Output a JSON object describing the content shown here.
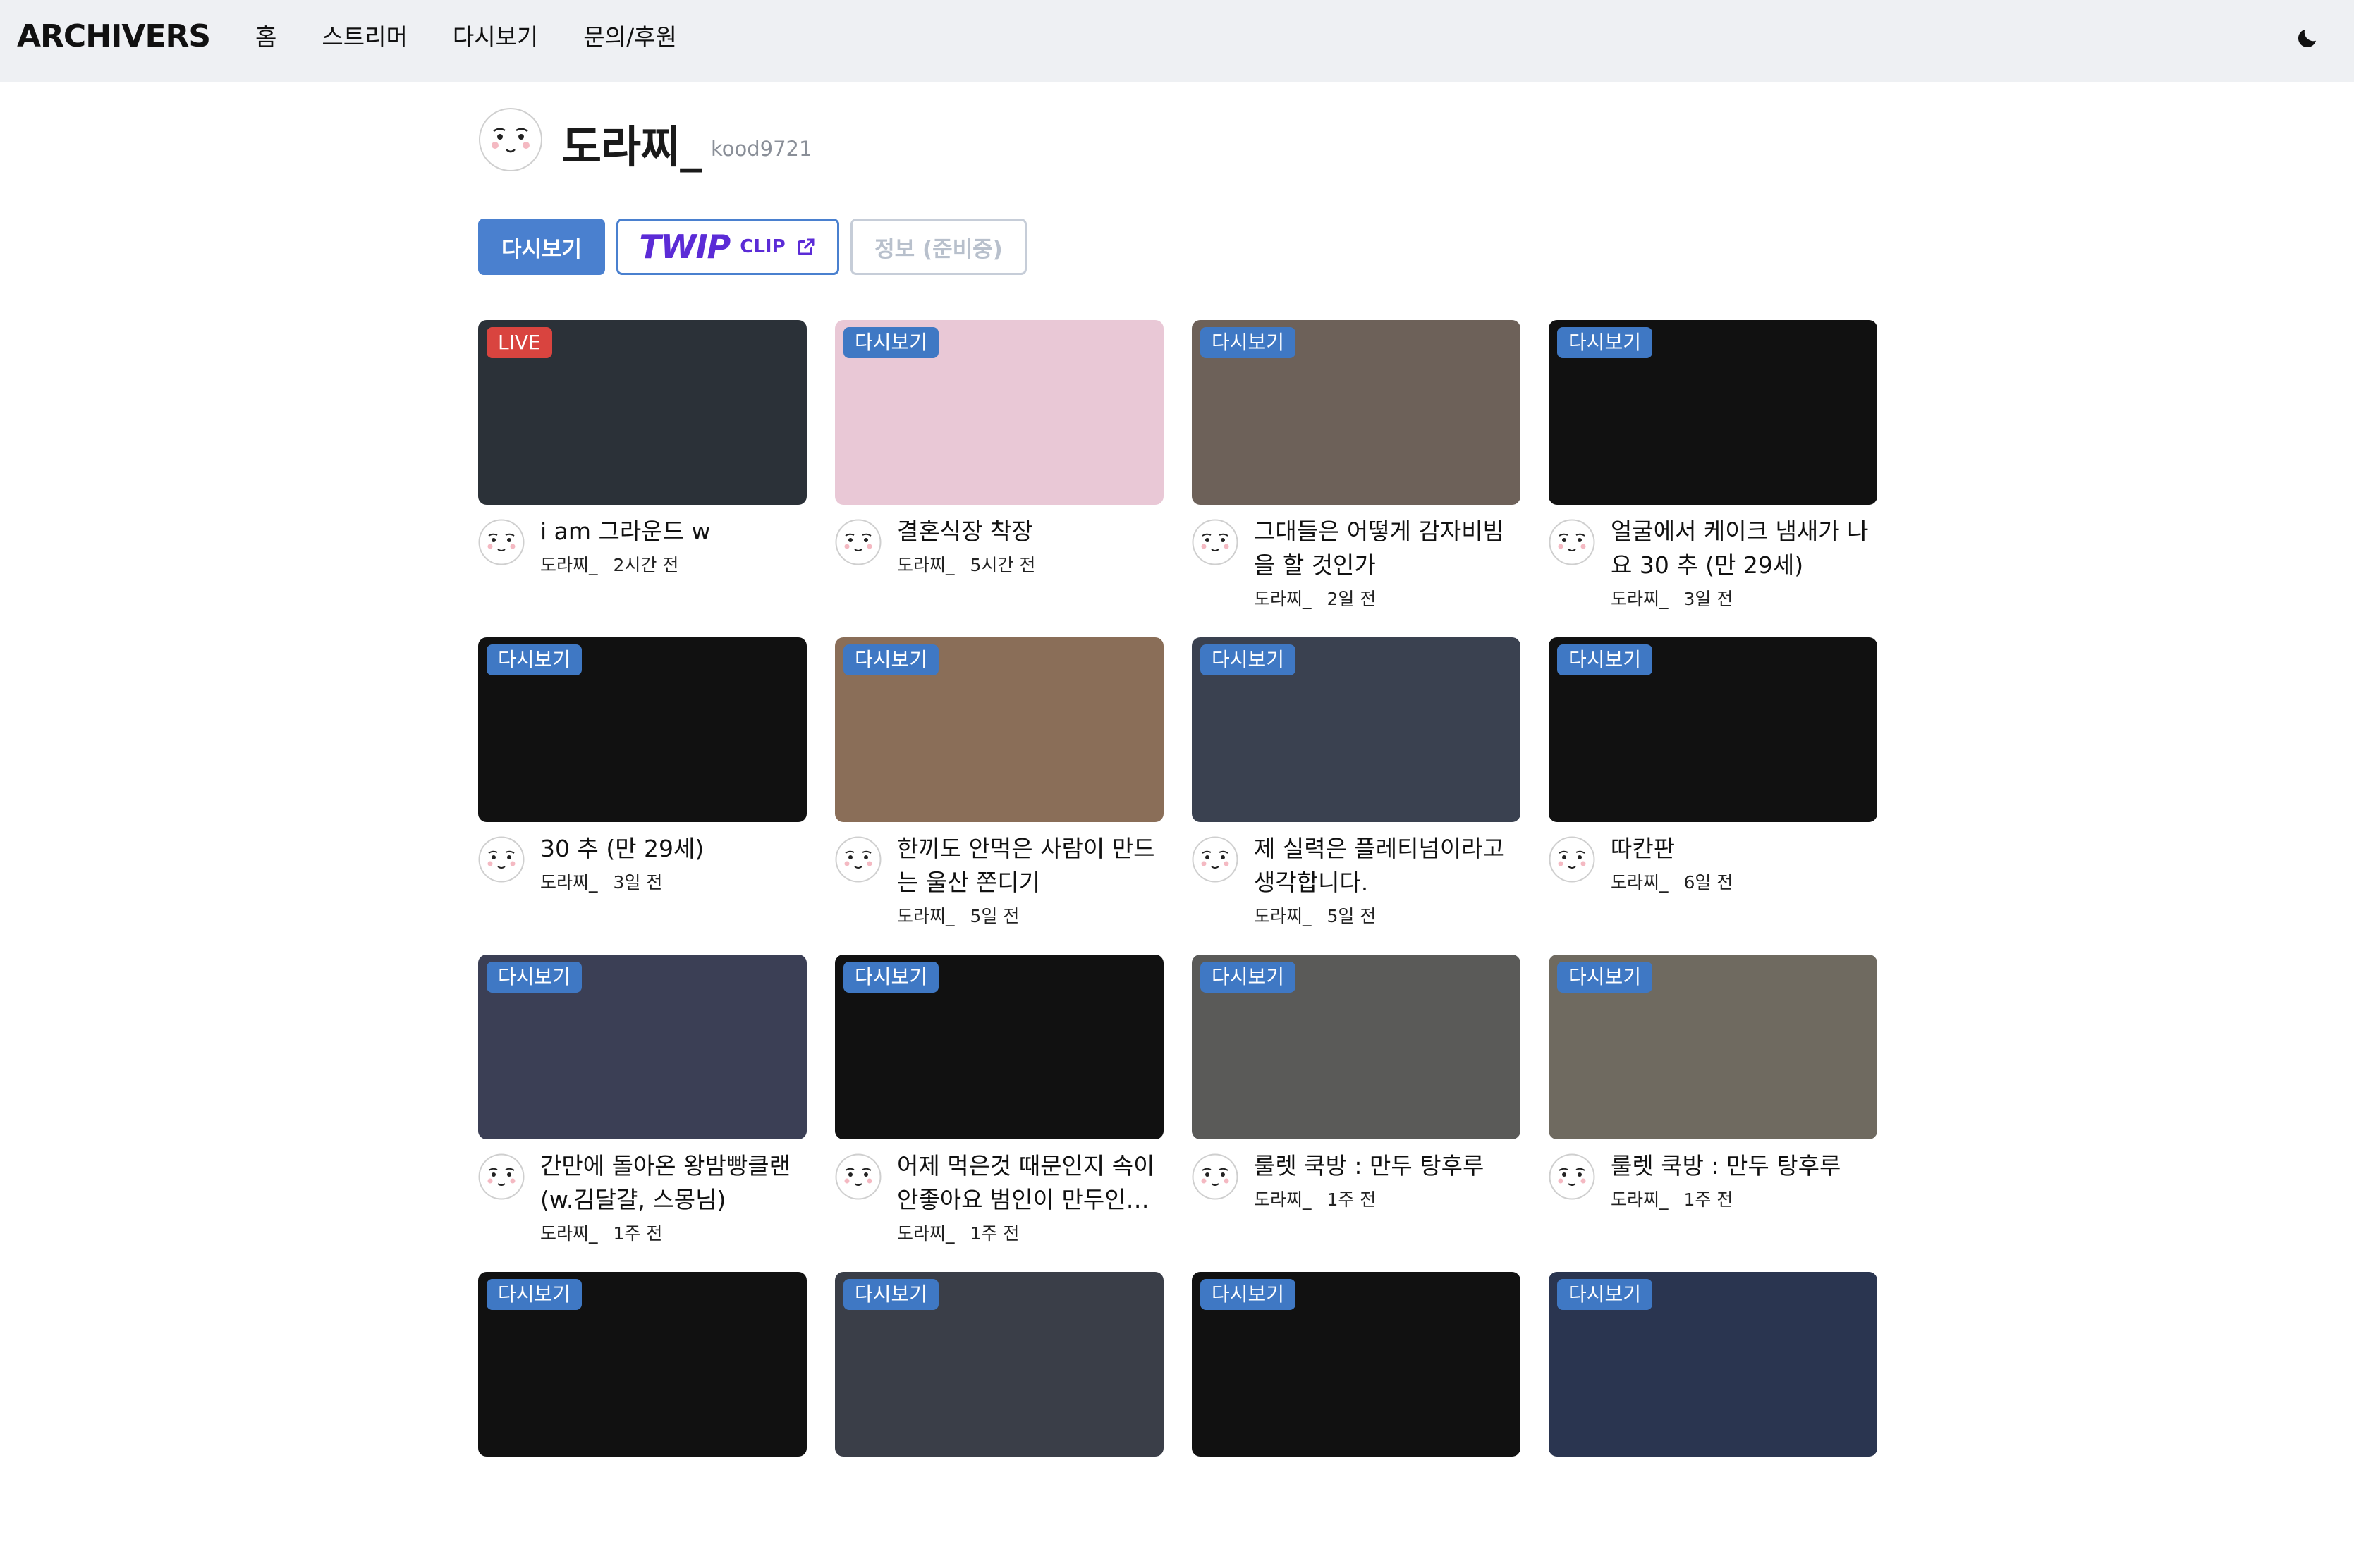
{
  "header": {
    "logo": "ARCHIVERS",
    "nav": [
      "홈",
      "스트리머",
      "다시보기",
      "문의/후원"
    ]
  },
  "profile": {
    "name": "도라찌_",
    "id": "kood9721"
  },
  "tabs": {
    "replay": "다시보기",
    "twip": "TWIP",
    "clip": "CLIP",
    "info": "정보 (준비중)"
  },
  "colors": {
    "accent": "#4a80cf",
    "live": "#d9443f",
    "twip": "#5b2bd6"
  },
  "videos": [
    {
      "badge": "LIVE",
      "title": "i am 그라운드 w",
      "author": "도라찌_",
      "time": "2시간 전",
      "thumb": "#2b3138"
    },
    {
      "badge": "다시보기",
      "title": "결혼식장 착장",
      "author": "도라찌_",
      "time": "5시간 전",
      "thumb": "#e9c8d6"
    },
    {
      "badge": "다시보기",
      "title": "그대들은 어떻게 감자비빔을 할 것인가",
      "author": "도라찌_",
      "time": "2일 전",
      "thumb": "#6d6159"
    },
    {
      "badge": "다시보기",
      "title": "얼굴에서 케이크 냄새가 나요 30 추 (만 29세)",
      "author": "도라찌_",
      "time": "3일 전",
      "thumb": "#111111"
    },
    {
      "badge": "다시보기",
      "title": "30 추 (만 29세)",
      "author": "도라찌_",
      "time": "3일 전",
      "thumb": "#111111"
    },
    {
      "badge": "다시보기",
      "title": "한끼도 안먹은 사람이 만드는 울산 쫀디기",
      "author": "도라찌_",
      "time": "5일 전",
      "thumb": "#8a6e58"
    },
    {
      "badge": "다시보기",
      "title": "제 실력은 플레티넘이라고 생각합니다.",
      "author": "도라찌_",
      "time": "5일 전",
      "thumb": "#3a4150"
    },
    {
      "badge": "다시보기",
      "title": "따칸판",
      "author": "도라찌_",
      "time": "6일 전",
      "thumb": "#111111"
    },
    {
      "badge": "다시보기",
      "title": "간만에 돌아온 왕밤빵클랜 (w.김달걀, 스몽님)",
      "author": "도라찌_",
      "time": "1주 전",
      "thumb": "#3b3f55"
    },
    {
      "badge": "다시보기",
      "title": "어제 먹은것 때문인지 속이 안좋아요 범인이 만두인지 라면인지",
      "author": "도라찌_",
      "time": "1주 전",
      "thumb": "#111111"
    },
    {
      "badge": "다시보기",
      "title": "룰렛 쿡방 : 만두 탕후루",
      "author": "도라찌_",
      "time": "1주 전",
      "thumb": "#5a5a58"
    },
    {
      "badge": "다시보기",
      "title": "룰렛 쿡방 : 만두 탕후루",
      "author": "도라찌_",
      "time": "1주 전",
      "thumb": "#6f6a60"
    },
    {
      "badge": "다시보기",
      "title": "",
      "author": "",
      "time": "",
      "thumb": "#111111"
    },
    {
      "badge": "다시보기",
      "title": "",
      "author": "",
      "time": "",
      "thumb": "#3a3e48"
    },
    {
      "badge": "다시보기",
      "title": "",
      "author": "",
      "time": "",
      "thumb": "#111111"
    },
    {
      "badge": "다시보기",
      "title": "",
      "author": "",
      "time": "",
      "thumb": "#2a3550"
    }
  ]
}
